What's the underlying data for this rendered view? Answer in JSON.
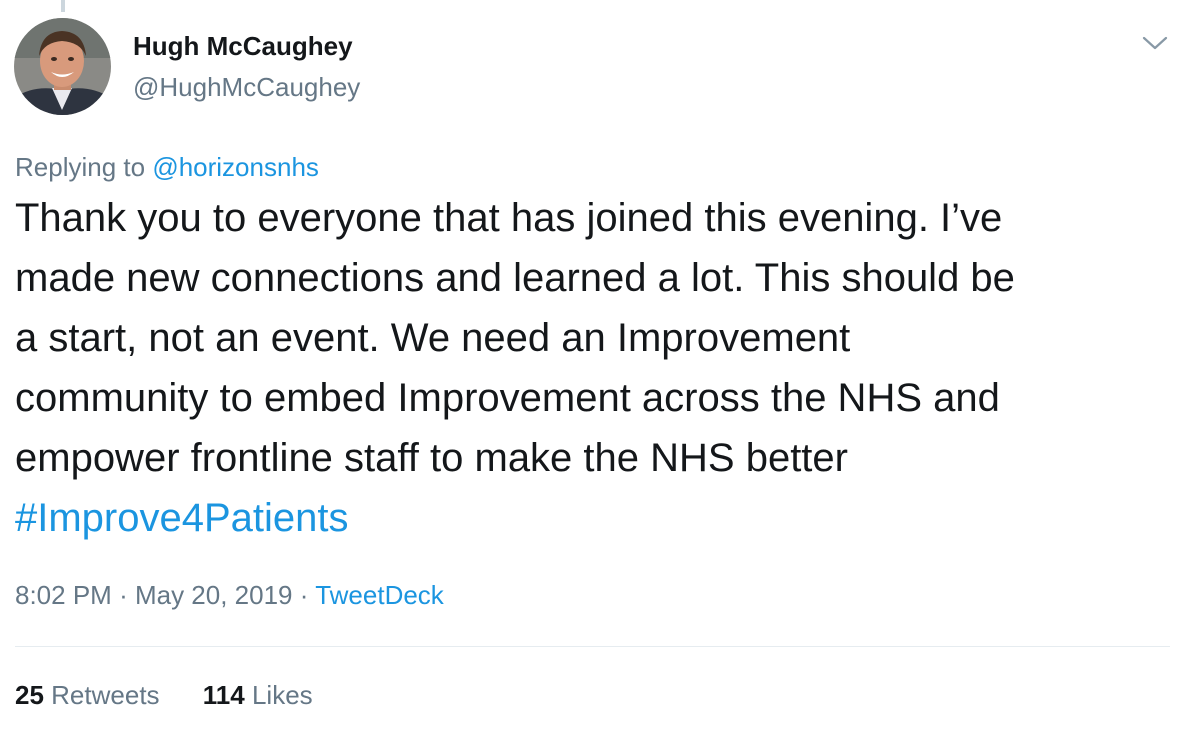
{
  "author": {
    "display_name": "Hugh McCaughey",
    "handle": "@HughMcCaughey"
  },
  "reply_context": {
    "prefix": "Replying to",
    "mention": "@horizonsnhs"
  },
  "tweet": {
    "lines": [
      "Thank you to everyone that has joined this evening. I’ve",
      "made new connections and learned a lot. This should be",
      "a start, not an event. We need an Improvement",
      "community to embed Improvement across the NHS and",
      "empower frontline staff to make the NHS better"
    ],
    "hashtag": "#Improve4Patients"
  },
  "meta": {
    "time": "8:02 PM",
    "separator": "·",
    "date": "May 20, 2019",
    "source": "TweetDeck"
  },
  "stats": {
    "retweets_count": "25",
    "retweets_label": "Retweets",
    "likes_count": "114",
    "likes_label": "Likes"
  },
  "colors": {
    "text": "#14171a",
    "secondary": "#657786",
    "link": "#1b95e0",
    "divider": "#e6ecf0"
  },
  "icons": {
    "menu": "chevron-down-icon"
  }
}
